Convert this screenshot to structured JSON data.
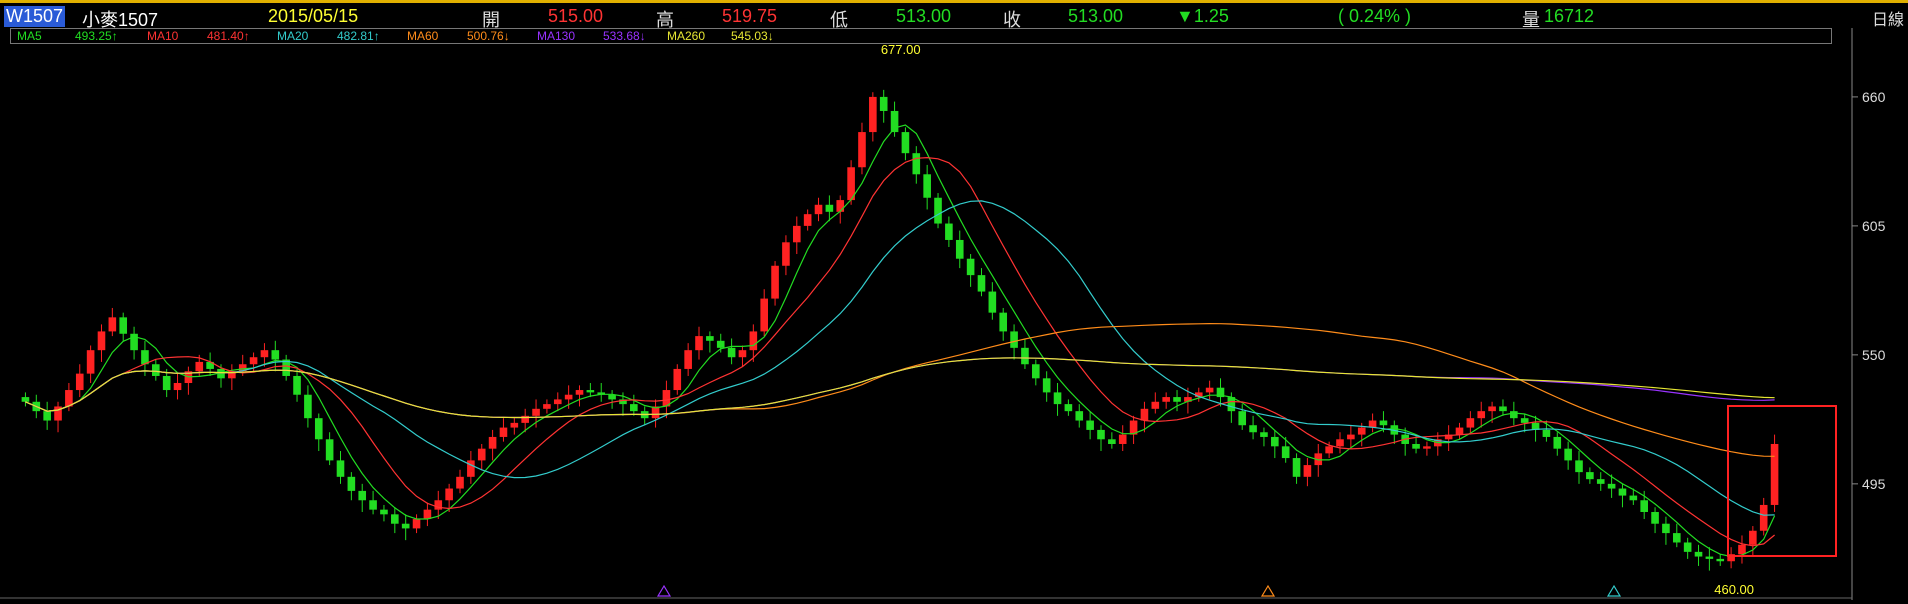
{
  "header": {
    "symbol": "W1507",
    "name": "小麥1507",
    "date": "2015/05/15",
    "open_label": "開",
    "open": "515.00",
    "high_label": "高",
    "high": "519.75",
    "low_label": "低",
    "low": "513.00",
    "close_label": "收",
    "close": "513.00",
    "change": "▼1.25",
    "change_pct": "( 0.24% )",
    "volume_label": "量",
    "volume": "16712",
    "period": "日線"
  },
  "ma": [
    {
      "label": "MA5",
      "value": "493.25↑",
      "color": "#22dd22"
    },
    {
      "label": "MA10",
      "value": "481.40↑",
      "color": "#ff3333"
    },
    {
      "label": "MA20",
      "value": "482.81↑",
      "color": "#33cccc"
    },
    {
      "label": "MA60",
      "value": "500.76↓",
      "color": "#ff8c1a"
    },
    {
      "label": "MA130",
      "value": "533.68↓",
      "color": "#9933ff"
    },
    {
      "label": "MA260",
      "value": "545.03↓",
      "color": "#e6e633"
    }
  ],
  "chart_data": {
    "type": "candlestick",
    "title": "",
    "xlabel": "",
    "ylabel": "",
    "ylim": [
      454,
      680
    ],
    "y_ticks": [
      660,
      605,
      550,
      495
    ],
    "annotations": {
      "max_label": "677.00",
      "min_label": "460.00"
    },
    "colors": {
      "up": "#ff2222",
      "down": "#22dd22",
      "ma5": "#22dd22",
      "ma10": "#ff3333",
      "ma20": "#33cccc",
      "ma60": "#ff8c1a",
      "ma130": "#9933ff",
      "ma260": "#e6e633"
    },
    "close": [
      530,
      526,
      522,
      528,
      535,
      542,
      552,
      560,
      566,
      559,
      552,
      546,
      541,
      535,
      538,
      543,
      547,
      544,
      540,
      543,
      546,
      549,
      552,
      548,
      541,
      533,
      523,
      514,
      505,
      498,
      492,
      488,
      484,
      482,
      478,
      476,
      480,
      484,
      488,
      493,
      498,
      505,
      510,
      515,
      519,
      521,
      524,
      527,
      529,
      531,
      533,
      535,
      534,
      533,
      531,
      529,
      526,
      523,
      528,
      535,
      544,
      552,
      558,
      556,
      553,
      549,
      552,
      560,
      574,
      588,
      598,
      605,
      610,
      614,
      611,
      616,
      630,
      645,
      660,
      654,
      645,
      636,
      627,
      617,
      606,
      599,
      591,
      584,
      577,
      568,
      560,
      553,
      546,
      540,
      534,
      529,
      526,
      522,
      518,
      514,
      512,
      516,
      522,
      527,
      530,
      532,
      530,
      532,
      534,
      536,
      532,
      526,
      520,
      517,
      515,
      511,
      506,
      498,
      503,
      508,
      511,
      514,
      516,
      519,
      522,
      520,
      516,
      512,
      510,
      511,
      514,
      516,
      519,
      523,
      526,
      528,
      526,
      523,
      521,
      518,
      515,
      510,
      505,
      500,
      497,
      495,
      493,
      490,
      488,
      483,
      478,
      474,
      470,
      466,
      464,
      463,
      462,
      465,
      469,
      475,
      486,
      512
    ],
    "ma_values": {
      "MA5": "493.25",
      "MA10": "481.40",
      "MA20": "482.81",
      "MA60": "500.76",
      "MA130": "533.68",
      "MA260": "545.03"
    }
  }
}
